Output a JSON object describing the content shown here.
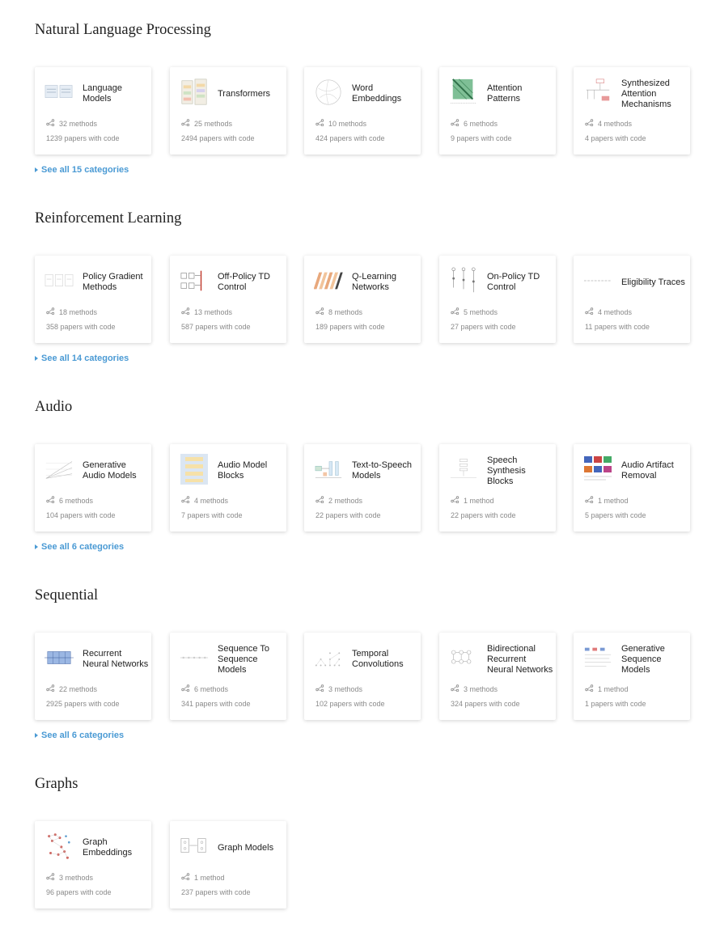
{
  "areas": [
    {
      "title": "Natural Language Processing",
      "see_all": "See all 15 categories",
      "cards": [
        {
          "name": "Language Models",
          "thumb": "lm-diagram",
          "methods": "32 methods",
          "papers": "1239 papers with code"
        },
        {
          "name": "Transformers",
          "thumb": "transformer-diagram",
          "methods": "25 methods",
          "papers": "2494 papers with code"
        },
        {
          "name": "Word Embeddings",
          "thumb": "embedding-circle",
          "methods": "10 methods",
          "papers": "424 papers with code"
        },
        {
          "name": "Attention Patterns",
          "thumb": "attention-grid",
          "methods": "6 methods",
          "papers": "9 papers with code"
        },
        {
          "name": "Synthesized Attention Mechanisms",
          "thumb": "synth-diagram",
          "methods": "4 methods",
          "papers": "4 papers with code"
        }
      ]
    },
    {
      "title": "Reinforcement Learning",
      "see_all": "See all 14 categories",
      "cards": [
        {
          "name": "Policy Gradient Methods",
          "thumb": "pg-diagram",
          "methods": "18 methods",
          "papers": "358 papers with code"
        },
        {
          "name": "Off-Policy TD Control",
          "thumb": "td-diagram",
          "methods": "13 methods",
          "papers": "587 papers with code"
        },
        {
          "name": "Q-Learning Networks",
          "thumb": "qnet-diagram",
          "methods": "8 methods",
          "papers": "189 papers with code"
        },
        {
          "name": "On-Policy TD Control",
          "thumb": "onpolicy-diagram",
          "methods": "5 methods",
          "papers": "27 papers with code"
        },
        {
          "name": "Eligibility Traces",
          "thumb": "trace-formula",
          "methods": "4 methods",
          "papers": "11 papers with code"
        }
      ]
    },
    {
      "title": "Audio",
      "see_all": "See all 6 categories",
      "cards": [
        {
          "name": "Generative Audio Models",
          "thumb": "audio-gen-diagram",
          "methods": "6 methods",
          "papers": "104 papers with code"
        },
        {
          "name": "Audio Model Blocks",
          "thumb": "audio-block-diagram",
          "methods": "4 methods",
          "papers": "7 papers with code"
        },
        {
          "name": "Text-to-Speech Models",
          "thumb": "tts-diagram",
          "methods": "2 methods",
          "papers": "22 papers with code"
        },
        {
          "name": "Speech Synthesis Blocks",
          "thumb": "speech-block-diagram",
          "methods": "1 method",
          "papers": "22 papers with code"
        },
        {
          "name": "Audio Artifact Removal",
          "thumb": "spectrogram-grid",
          "methods": "1 method",
          "papers": "5 papers with code"
        }
      ]
    },
    {
      "title": "Sequential",
      "see_all": "See all 6 categories",
      "cards": [
        {
          "name": "Recurrent Neural Networks",
          "thumb": "rnn-diagram",
          "methods": "22 methods",
          "papers": "2925 papers with code"
        },
        {
          "name": "Sequence To Sequence Models",
          "thumb": "seq2seq-diagram",
          "methods": "6 methods",
          "papers": "341 papers with code"
        },
        {
          "name": "Temporal Convolutions",
          "thumb": "tconv-diagram",
          "methods": "3 methods",
          "papers": "102 papers with code"
        },
        {
          "name": "Bidirectional Recurrent Neural Networks",
          "thumb": "birnn-diagram",
          "methods": "3 methods",
          "papers": "324 papers with code"
        },
        {
          "name": "Generative Sequence Models",
          "thumb": "genseq-diagram",
          "methods": "1 method",
          "papers": "1 papers with code"
        }
      ]
    },
    {
      "title": "Graphs",
      "cards": [
        {
          "name": "Graph Embeddings",
          "thumb": "graph-embedding-diagram",
          "methods": "3 methods",
          "papers": "96 papers with code"
        },
        {
          "name": "Graph Models",
          "thumb": "graph-model-diagram",
          "methods": "1 method",
          "papers": "237 papers with code"
        }
      ]
    }
  ],
  "colors": {
    "link": "#4a9ad4",
    "meta": "#8a8a8a",
    "title": "#222222"
  }
}
